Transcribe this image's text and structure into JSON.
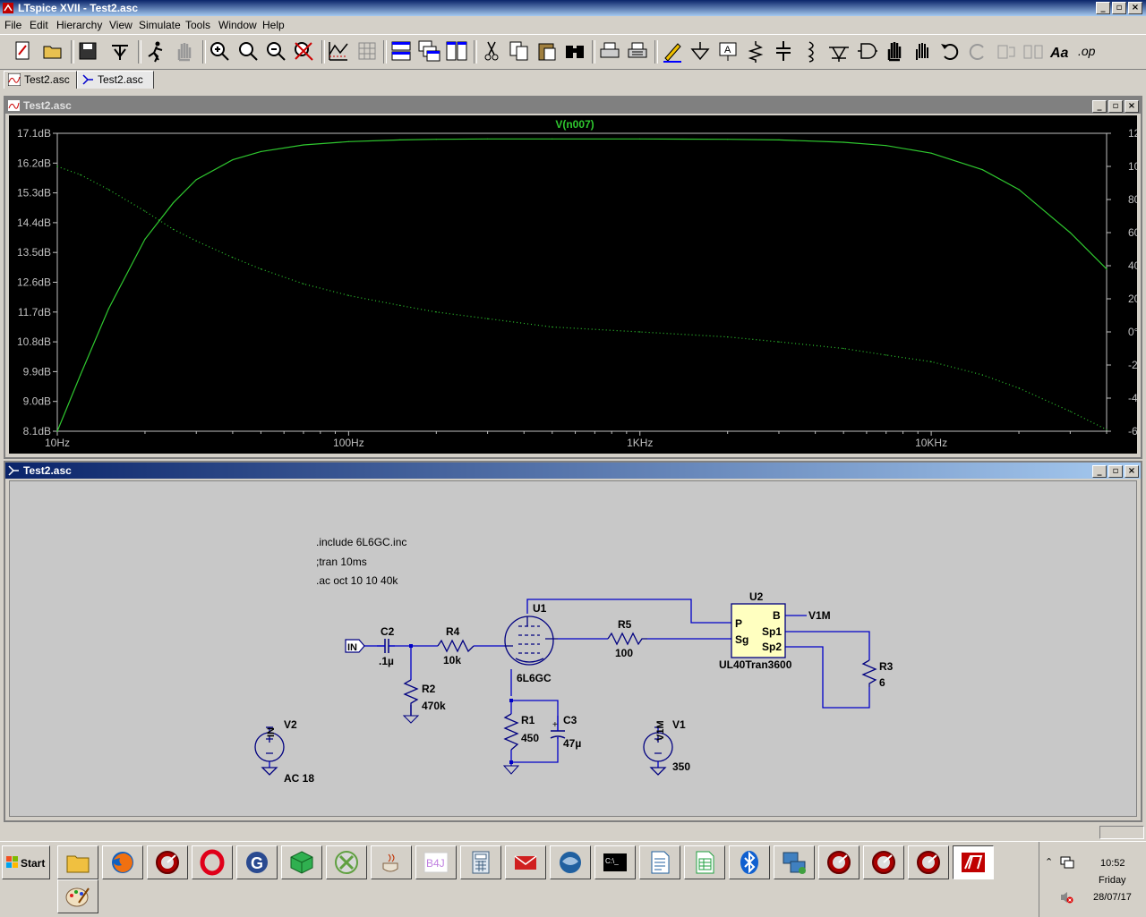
{
  "window": {
    "title": "LTspice XVII - Test2.asc"
  },
  "menu": [
    "File",
    "Edit",
    "Hierarchy",
    "View",
    "Simulate",
    "Tools",
    "Window",
    "Help"
  ],
  "toolbar": {
    "icons": [
      "new-schematic",
      "open",
      "save",
      "control-panel",
      "run",
      "halt",
      "zoom-in",
      "zoom-pan",
      "zoom-out",
      "zoom-fit",
      "autorange",
      "grid",
      "tile-horizontal",
      "cascade",
      "tile-vertical",
      "cut",
      "copy",
      "paste",
      "find",
      "print-setup",
      "print",
      "draw-wire",
      "ground",
      "label-net",
      "resistor",
      "capacitor",
      "inductor",
      "diode",
      "component",
      "move",
      "drag",
      "undo",
      "redo",
      "rotate",
      "mirror",
      "text",
      "spice-directive"
    ]
  },
  "tabs": [
    {
      "label": "Test2.asc",
      "icon": "waveform-icon"
    },
    {
      "label": "Test2.asc",
      "icon": "schematic-icon"
    }
  ],
  "plot_window": {
    "title": "Test2.asc"
  },
  "schematic_window": {
    "title": "Test2.asc"
  },
  "chart_data": {
    "type": "line",
    "title": "V(n007)",
    "xscale": "log",
    "x_ticks": [
      "10Hz",
      "100Hz",
      "1KHz",
      "10KHz"
    ],
    "xlim": [
      10,
      40000
    ],
    "y_left_ticks": [
      "17.1dB",
      "16.2dB",
      "15.3dB",
      "14.4dB",
      "13.5dB",
      "12.6dB",
      "11.7dB",
      "10.8dB",
      "9.9dB",
      "9.0dB",
      "8.1dB"
    ],
    "ylim_left": [
      8.1,
      17.1
    ],
    "y_right_ticks": [
      "120°",
      "100°",
      "80°",
      "60°",
      "40°",
      "20°",
      "0°",
      "-20°",
      "-40°",
      "-60°"
    ],
    "ylim_right": [
      -60,
      120
    ],
    "grid": false,
    "colors": {
      "magnitude": "#2fc82f",
      "phase": "#2fc82f",
      "title": "#2fc82f",
      "background": "#000000",
      "axis": "#c0c0c0"
    },
    "series": [
      {
        "style": "solid",
        "axis": "left",
        "x": [
          10,
          12,
          15,
          20,
          25,
          30,
          40,
          50,
          70,
          100,
          150,
          200,
          300,
          500,
          1000,
          2000,
          3000,
          5000,
          7000,
          10000,
          15000,
          20000,
          30000,
          40000
        ],
        "y": [
          8.1,
          9.8,
          11.8,
          13.9,
          15.0,
          15.7,
          16.3,
          16.55,
          16.75,
          16.85,
          16.9,
          16.92,
          16.93,
          16.93,
          16.93,
          16.92,
          16.9,
          16.83,
          16.73,
          16.5,
          16.0,
          15.4,
          14.1,
          13.0
        ]
      },
      {
        "style": "dotted",
        "axis": "right",
        "x": [
          10,
          12,
          15,
          20,
          25,
          30,
          40,
          50,
          70,
          100,
          150,
          200,
          300,
          500,
          1000,
          2000,
          3000,
          5000,
          7000,
          10000,
          15000,
          20000,
          30000,
          40000
        ],
        "y": [
          100,
          95,
          86,
          73,
          62,
          55,
          45,
          38,
          29,
          22,
          16,
          12,
          8,
          3,
          0,
          -3,
          -6,
          -10,
          -14,
          -18,
          -26,
          -34,
          -48,
          -59
        ]
      }
    ]
  },
  "schematic": {
    "directives": [
      ".include 6L6GC.inc",
      ";tran 10ms",
      ".ac oct 10 10 40k"
    ],
    "labels": {
      "in": "IN",
      "c2_name": "C2",
      "c2_value": ".1µ",
      "r4_name": "R4",
      "r4_value": "10k",
      "r2_name": "R2",
      "r2_value": "470k",
      "u1_name": "U1",
      "u1_value": "6L6GC",
      "r5_name": "R5",
      "r5_value": "100",
      "u2_name": "U2",
      "u2_value": "UL40Tran3600",
      "u2_pin_p": "P",
      "u2_pin_sg": "Sg",
      "u2_pin_b": "B",
      "u2_pin_sp1": "Sp1",
      "u2_pin_sp2": "Sp2",
      "v1m_net": "V1M",
      "r3_name": "R3",
      "r3_value": "6",
      "r1_name": "R1",
      "r1_value": "450",
      "c3_name": "C3",
      "c3_value": "47µ",
      "v2_net": "IN",
      "v2_name": "V2",
      "v2_value": "AC 18",
      "v1_net": "V1M",
      "v1_name": "V1",
      "v1_value": "350"
    },
    "colors": {
      "wire": "#0000c8",
      "component": "#000080",
      "text": "#000000",
      "background": "#c8c8c8",
      "part_fill": "#ffffc0"
    }
  },
  "taskbar": {
    "start_label": "Start",
    "apps": [
      "file-manager",
      "firefox",
      "gdisk",
      "opera",
      "google",
      "3d-box",
      "xbox",
      "java",
      "b4j",
      "calculator",
      "mail",
      "thunderbird",
      "console",
      "writer",
      "calc",
      "bluetooth",
      "network",
      "gdisk",
      "gdisk",
      "gdisk",
      "ltspice",
      "paint"
    ],
    "b4j_label": "B4J",
    "console_label": "C:\\_",
    "time": "10:52",
    "day": "Friday",
    "date": "28/07/17"
  }
}
